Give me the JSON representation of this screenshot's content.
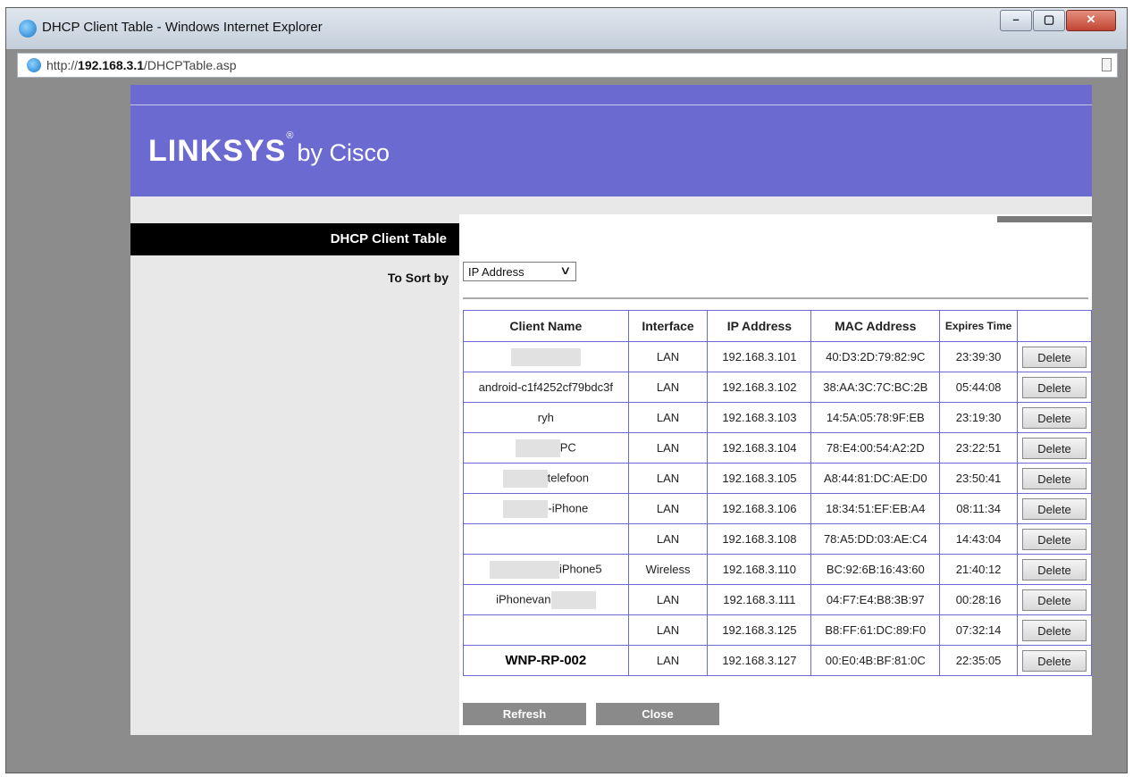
{
  "window": {
    "title": "DHCP Client Table - Windows Internet Explorer",
    "controls": {
      "minimize": "–",
      "maximize": "▢",
      "close": "✕"
    }
  },
  "address_bar": {
    "prefix": "http://",
    "host": "192.168.3.1",
    "path": "/DHCPTable.asp"
  },
  "header": {
    "brand": "LINKSYS",
    "registered": "®",
    "by": "by Cisco",
    "brand_color": "#6a6ad0"
  },
  "sidebar": {
    "title": "DHCP Client Table",
    "sort_label": "To Sort by"
  },
  "sort": {
    "selected": "IP Address"
  },
  "table": {
    "columns": [
      "Client Name",
      "Interface",
      "IP Address",
      "MAC Address",
      "Expires Time",
      ""
    ],
    "rows": [
      {
        "name": "",
        "name_redact": "full",
        "interface": "LAN",
        "ip": "192.168.3.101",
        "mac": "40:D3:2D:79:82:9C",
        "expires": "23:39:30",
        "action": "Delete"
      },
      {
        "name": "android-c1f4252cf79bdc3f",
        "interface": "LAN",
        "ip": "192.168.3.102",
        "mac": "38:AA:3C:7C:BC:2B",
        "expires": "05:44:08",
        "action": "Delete"
      },
      {
        "name": "ryh",
        "interface": "LAN",
        "ip": "192.168.3.103",
        "mac": "14:5A:05:78:9F:EB",
        "expires": "23:19:30",
        "action": "Delete"
      },
      {
        "name": "PC",
        "name_redact": "before",
        "interface": "LAN",
        "ip": "192.168.3.104",
        "mac": "78:E4:00:54:A2:2D",
        "expires": "23:22:51",
        "action": "Delete"
      },
      {
        "name": "telefoon",
        "name_redact": "before",
        "interface": "LAN",
        "ip": "192.168.3.105",
        "mac": "A8:44:81:DC:AE:D0",
        "expires": "23:50:41",
        "action": "Delete"
      },
      {
        "name": "-iPhone",
        "name_redact": "before",
        "interface": "LAN",
        "ip": "192.168.3.106",
        "mac": "18:34:51:EF:EB:A4",
        "expires": "08:11:34",
        "action": "Delete"
      },
      {
        "name": "",
        "interface": "LAN",
        "ip": "192.168.3.108",
        "mac": "78:A5:DD:03:AE:C4",
        "expires": "14:43:04",
        "action": "Delete"
      },
      {
        "name": "iPhone5",
        "name_redact": "before",
        "interface": "Wireless",
        "ip": "192.168.3.110",
        "mac": "BC:92:6B:16:43:60",
        "expires": "21:40:12",
        "action": "Delete"
      },
      {
        "name": "iPhonevan",
        "name_redact": "after",
        "interface": "LAN",
        "ip": "192.168.3.111",
        "mac": "04:F7:E4:B8:3B:97",
        "expires": "00:28:16",
        "action": "Delete"
      },
      {
        "name": "",
        "interface": "LAN",
        "ip": "192.168.3.125",
        "mac": "B8:FF:61:DC:89:F0",
        "expires": "07:32:14",
        "action": "Delete"
      },
      {
        "name": "WNP-RP-002",
        "bold": true,
        "interface": "LAN",
        "ip": "192.168.3.127",
        "mac": "00:E0:4B:BF:81:0C",
        "expires": "22:35:05",
        "action": "Delete"
      }
    ]
  },
  "buttons": {
    "refresh": "Refresh",
    "close": "Close"
  }
}
